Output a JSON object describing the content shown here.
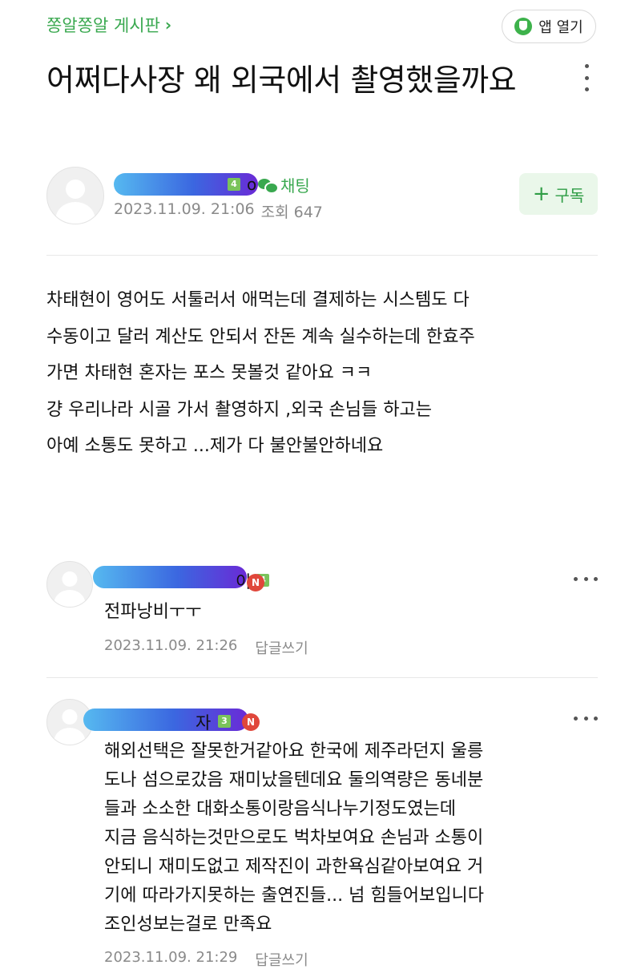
{
  "header": {
    "board_name": "쫑알쫑알 게시판",
    "app_open_label": "앱 열기"
  },
  "post": {
    "title": "어쩌다사장 왜 외국에서 촬영했을까요",
    "author": {
      "nickname_tail": "o",
      "level": "4"
    },
    "chat_label": "채팅",
    "date": "2023.11.09. 21:06",
    "views_label": "조회 647",
    "subscribe_label": "구독",
    "body_lines": [
      "차태현이 영어도 서툴러서 애먹는데 결제하는 시스템도 다",
      "수동이고 달러 계산도 안되서 잔돈 계속 실수하는데 한효주",
      "가면 차태현 혼자는 포스 못볼것 같아요 ㅋㅋ",
      "걍 우리나라 시골 가서 촬영하지 ,외국 손님들 하고는",
      "아예 소통도 못하고 ...제가 다 불안불안하네요"
    ]
  },
  "comments": [
    {
      "nickname_tail": "이",
      "level": "4",
      "new_badge": "N",
      "lines": [
        "전파낭비ㅜㅜ"
      ],
      "date": "2023.11.09. 21:26",
      "reply_label": "답글쓰기"
    },
    {
      "nickname_tail": "자",
      "level": "3",
      "new_badge": "N",
      "lines": [
        "해외선택은 잘못한거같아요 한국에 제주라던지 울릉",
        "도나 섬으로갔음 재미났을텐데요 둘의역량은 동네분",
        "들과 소소한 대화소통이랑음식나누기정도였는데",
        "지금 음식하는것만으로도 벅차보여요 손님과 소통이",
        "안되니 재미도없고 제작진이 과한욕심같아보여요 거",
        "기에 따라가지못하는 출연진들... 넘 힘들어보입니다",
        "조인성보는걸로 만족요"
      ],
      "date": "2023.11.09. 21:29",
      "reply_label": "답글쓰기"
    }
  ],
  "colors": {
    "accent_green": "#39a84f",
    "new_badge_red": "#e0473b",
    "redaction_gradient": [
      "#56b9f0",
      "#3b67e0",
      "#6a2ad6"
    ]
  }
}
